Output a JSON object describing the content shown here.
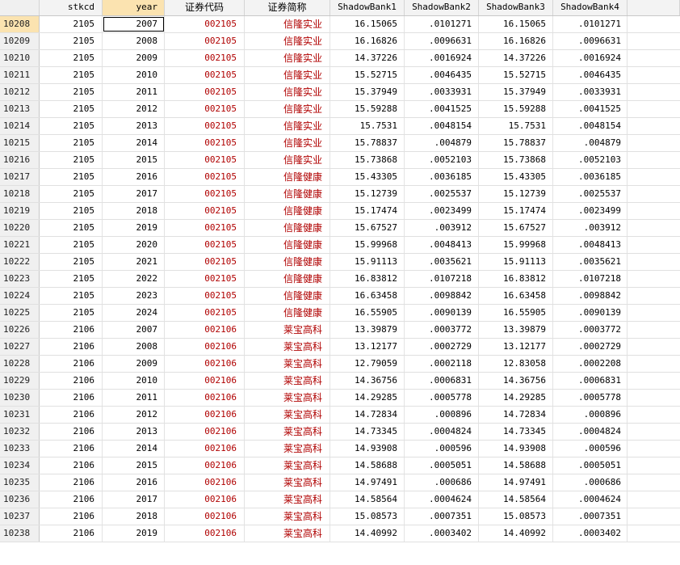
{
  "columns": {
    "stkcd": "stkcd",
    "year": "year",
    "code": "证券代码",
    "name": "证券简称",
    "sb1": "ShadowBank1",
    "sb2": "ShadowBank2",
    "sb3": "ShadowBank3",
    "sb4": "ShadowBank4"
  },
  "rows": [
    {
      "rn": "10208",
      "stkcd": "2105",
      "year": "2007",
      "code": "002105",
      "name": "信隆实业",
      "sb1": "16.15065",
      "sb2": ".0101271",
      "sb3": "16.15065",
      "sb4": ".0101271"
    },
    {
      "rn": "10209",
      "stkcd": "2105",
      "year": "2008",
      "code": "002105",
      "name": "信隆实业",
      "sb1": "16.16826",
      "sb2": ".0096631",
      "sb3": "16.16826",
      "sb4": ".0096631"
    },
    {
      "rn": "10210",
      "stkcd": "2105",
      "year": "2009",
      "code": "002105",
      "name": "信隆实业",
      "sb1": "14.37226",
      "sb2": ".0016924",
      "sb3": "14.37226",
      "sb4": ".0016924"
    },
    {
      "rn": "10211",
      "stkcd": "2105",
      "year": "2010",
      "code": "002105",
      "name": "信隆实业",
      "sb1": "15.52715",
      "sb2": ".0046435",
      "sb3": "15.52715",
      "sb4": ".0046435"
    },
    {
      "rn": "10212",
      "stkcd": "2105",
      "year": "2011",
      "code": "002105",
      "name": "信隆实业",
      "sb1": "15.37949",
      "sb2": ".0033931",
      "sb3": "15.37949",
      "sb4": ".0033931"
    },
    {
      "rn": "10213",
      "stkcd": "2105",
      "year": "2012",
      "code": "002105",
      "name": "信隆实业",
      "sb1": "15.59288",
      "sb2": ".0041525",
      "sb3": "15.59288",
      "sb4": ".0041525"
    },
    {
      "rn": "10214",
      "stkcd": "2105",
      "year": "2013",
      "code": "002105",
      "name": "信隆实业",
      "sb1": "15.7531",
      "sb2": ".0048154",
      "sb3": "15.7531",
      "sb4": ".0048154"
    },
    {
      "rn": "10215",
      "stkcd": "2105",
      "year": "2014",
      "code": "002105",
      "name": "信隆实业",
      "sb1": "15.78837",
      "sb2": ".004879",
      "sb3": "15.78837",
      "sb4": ".004879"
    },
    {
      "rn": "10216",
      "stkcd": "2105",
      "year": "2015",
      "code": "002105",
      "name": "信隆实业",
      "sb1": "15.73868",
      "sb2": ".0052103",
      "sb3": "15.73868",
      "sb4": ".0052103"
    },
    {
      "rn": "10217",
      "stkcd": "2105",
      "year": "2016",
      "code": "002105",
      "name": "信隆健康",
      "sb1": "15.43305",
      "sb2": ".0036185",
      "sb3": "15.43305",
      "sb4": ".0036185"
    },
    {
      "rn": "10218",
      "stkcd": "2105",
      "year": "2017",
      "code": "002105",
      "name": "信隆健康",
      "sb1": "15.12739",
      "sb2": ".0025537",
      "sb3": "15.12739",
      "sb4": ".0025537"
    },
    {
      "rn": "10219",
      "stkcd": "2105",
      "year": "2018",
      "code": "002105",
      "name": "信隆健康",
      "sb1": "15.17474",
      "sb2": ".0023499",
      "sb3": "15.17474",
      "sb4": ".0023499"
    },
    {
      "rn": "10220",
      "stkcd": "2105",
      "year": "2019",
      "code": "002105",
      "name": "信隆健康",
      "sb1": "15.67527",
      "sb2": ".003912",
      "sb3": "15.67527",
      "sb4": ".003912"
    },
    {
      "rn": "10221",
      "stkcd": "2105",
      "year": "2020",
      "code": "002105",
      "name": "信隆健康",
      "sb1": "15.99968",
      "sb2": ".0048413",
      "sb3": "15.99968",
      "sb4": ".0048413"
    },
    {
      "rn": "10222",
      "stkcd": "2105",
      "year": "2021",
      "code": "002105",
      "name": "信隆健康",
      "sb1": "15.91113",
      "sb2": ".0035621",
      "sb3": "15.91113",
      "sb4": ".0035621"
    },
    {
      "rn": "10223",
      "stkcd": "2105",
      "year": "2022",
      "code": "002105",
      "name": "信隆健康",
      "sb1": "16.83812",
      "sb2": ".0107218",
      "sb3": "16.83812",
      "sb4": ".0107218"
    },
    {
      "rn": "10224",
      "stkcd": "2105",
      "year": "2023",
      "code": "002105",
      "name": "信隆健康",
      "sb1": "16.63458",
      "sb2": ".0098842",
      "sb3": "16.63458",
      "sb4": ".0098842"
    },
    {
      "rn": "10225",
      "stkcd": "2105",
      "year": "2024",
      "code": "002105",
      "name": "信隆健康",
      "sb1": "16.55905",
      "sb2": ".0090139",
      "sb3": "16.55905",
      "sb4": ".0090139"
    },
    {
      "rn": "10226",
      "stkcd": "2106",
      "year": "2007",
      "code": "002106",
      "name": "莱宝高科",
      "sb1": "13.39879",
      "sb2": ".0003772",
      "sb3": "13.39879",
      "sb4": ".0003772"
    },
    {
      "rn": "10227",
      "stkcd": "2106",
      "year": "2008",
      "code": "002106",
      "name": "莱宝高科",
      "sb1": "13.12177",
      "sb2": ".0002729",
      "sb3": "13.12177",
      "sb4": ".0002729"
    },
    {
      "rn": "10228",
      "stkcd": "2106",
      "year": "2009",
      "code": "002106",
      "name": "莱宝高科",
      "sb1": "12.79059",
      "sb2": ".0002118",
      "sb3": "12.83058",
      "sb4": ".0002208"
    },
    {
      "rn": "10229",
      "stkcd": "2106",
      "year": "2010",
      "code": "002106",
      "name": "莱宝高科",
      "sb1": "14.36756",
      "sb2": ".0006831",
      "sb3": "14.36756",
      "sb4": ".0006831"
    },
    {
      "rn": "10230",
      "stkcd": "2106",
      "year": "2011",
      "code": "002106",
      "name": "莱宝高科",
      "sb1": "14.29285",
      "sb2": ".0005778",
      "sb3": "14.29285",
      "sb4": ".0005778"
    },
    {
      "rn": "10231",
      "stkcd": "2106",
      "year": "2012",
      "code": "002106",
      "name": "莱宝高科",
      "sb1": "14.72834",
      "sb2": ".000896",
      "sb3": "14.72834",
      "sb4": ".000896"
    },
    {
      "rn": "10232",
      "stkcd": "2106",
      "year": "2013",
      "code": "002106",
      "name": "莱宝高科",
      "sb1": "14.73345",
      "sb2": ".0004824",
      "sb3": "14.73345",
      "sb4": ".0004824"
    },
    {
      "rn": "10233",
      "stkcd": "2106",
      "year": "2014",
      "code": "002106",
      "name": "莱宝高科",
      "sb1": "14.93908",
      "sb2": ".000596",
      "sb3": "14.93908",
      "sb4": ".000596"
    },
    {
      "rn": "10234",
      "stkcd": "2106",
      "year": "2015",
      "code": "002106",
      "name": "莱宝高科",
      "sb1": "14.58688",
      "sb2": ".0005051",
      "sb3": "14.58688",
      "sb4": ".0005051"
    },
    {
      "rn": "10235",
      "stkcd": "2106",
      "year": "2016",
      "code": "002106",
      "name": "莱宝高科",
      "sb1": "14.97491",
      "sb2": ".000686",
      "sb3": "14.97491",
      "sb4": ".000686"
    },
    {
      "rn": "10236",
      "stkcd": "2106",
      "year": "2017",
      "code": "002106",
      "name": "莱宝高科",
      "sb1": "14.58564",
      "sb2": ".0004624",
      "sb3": "14.58564",
      "sb4": ".0004624"
    },
    {
      "rn": "10237",
      "stkcd": "2106",
      "year": "2018",
      "code": "002106",
      "name": "莱宝高科",
      "sb1": "15.08573",
      "sb2": ".0007351",
      "sb3": "15.08573",
      "sb4": ".0007351"
    },
    {
      "rn": "10238",
      "stkcd": "2106",
      "year": "2019",
      "code": "002106",
      "name": "莱宝高科",
      "sb1": "14.40992",
      "sb2": ".0003402",
      "sb3": "14.40992",
      "sb4": ".0003402"
    }
  ],
  "colors": {
    "string_text": "#b00000",
    "selection_highlight": "#fbe3b0",
    "header_bg": "#f3f3f3"
  }
}
